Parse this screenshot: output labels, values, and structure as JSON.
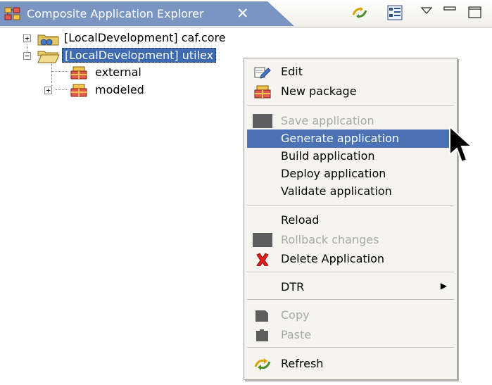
{
  "view": {
    "title": "Composite Application Explorer",
    "close_glyph": "✕",
    "toolbar_icons": [
      "link-with-editor-icon",
      "layout-icon",
      "view-menu-icon",
      "minimize-icon",
      "maximize-icon"
    ]
  },
  "tree": {
    "nodes": [
      {
        "label": "[LocalDevelopment] caf.core",
        "expander": "+",
        "icon": "project-folder-icon",
        "selected": false
      },
      {
        "label": "[LocalDevelopment] utilex",
        "expander": "−",
        "icon": "open-folder-icon",
        "selected": true
      },
      {
        "label": "external",
        "expander": "",
        "icon": "package-icon",
        "selected": false
      },
      {
        "label": "modeled",
        "expander": "+",
        "icon": "package-icon",
        "selected": false
      }
    ]
  },
  "context_menu": {
    "highlighted_item": "Generate application",
    "items": [
      {
        "label": "Edit",
        "icon": "edit-icon",
        "enabled": true
      },
      {
        "label": "New package",
        "icon": "package-icon",
        "enabled": true
      },
      {
        "label": "Save application",
        "icon": "disabled-placeholder-icon",
        "enabled": false
      },
      {
        "label": "Generate application",
        "enabled": true
      },
      {
        "label": "Build application",
        "enabled": true
      },
      {
        "label": "Deploy application",
        "enabled": true
      },
      {
        "label": "Validate application",
        "enabled": true
      },
      {
        "label": "Reload",
        "enabled": true
      },
      {
        "label": "Rollback changes",
        "icon": "disabled-placeholder-icon",
        "enabled": false
      },
      {
        "label": "Delete Application",
        "icon": "delete-icon",
        "enabled": true
      },
      {
        "label": "DTR",
        "submenu": true,
        "enabled": true
      },
      {
        "label": "Copy",
        "icon": "copy-icon",
        "enabled": false
      },
      {
        "label": "Paste",
        "icon": "paste-icon",
        "enabled": false
      },
      {
        "label": "Refresh",
        "icon": "refresh-icon",
        "enabled": true
      }
    ]
  },
  "colors": {
    "tab_active": "#7a95c2",
    "selection": "#3d6bb1",
    "menu_highlight": "#4a72b4",
    "menu_background": "#f5f4ef",
    "disabled_text": "#a8a8a8"
  }
}
